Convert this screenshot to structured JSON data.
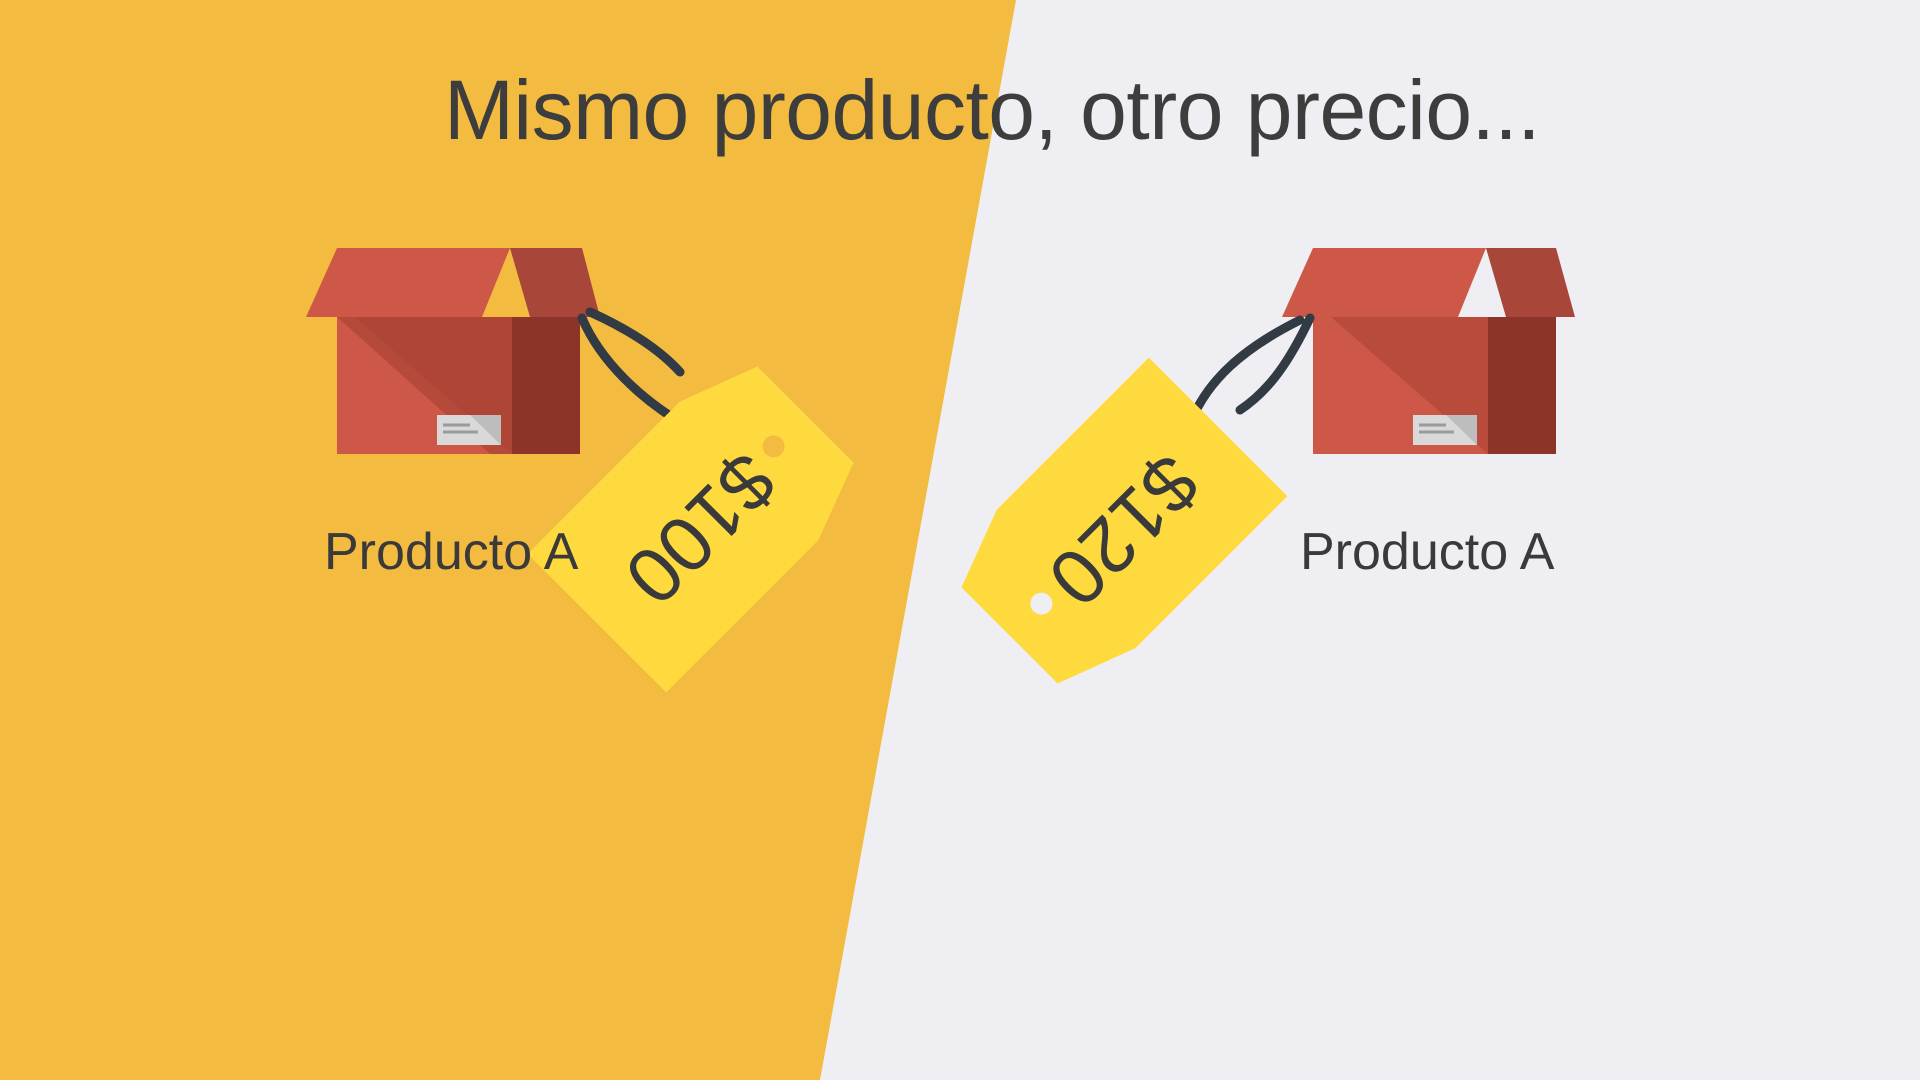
{
  "slide": {
    "title": "Mismo producto, otro precio...",
    "left": {
      "product_label": "Producto A",
      "price": "$100"
    },
    "right": {
      "product_label": "Producto A",
      "price": "$120"
    }
  },
  "colors": {
    "left_background": "#F3BC41",
    "right_background": "#EFEFF3",
    "box_front": "#CE5847",
    "box_shade": "#A84133",
    "box_side": "#8C332A",
    "box_lid": "#C9513F",
    "price_tag": "#FFDA3F",
    "string": "#323A44",
    "text": "#3D3D3D"
  },
  "icons": [
    "box-icon",
    "price-tag-icon"
  ]
}
